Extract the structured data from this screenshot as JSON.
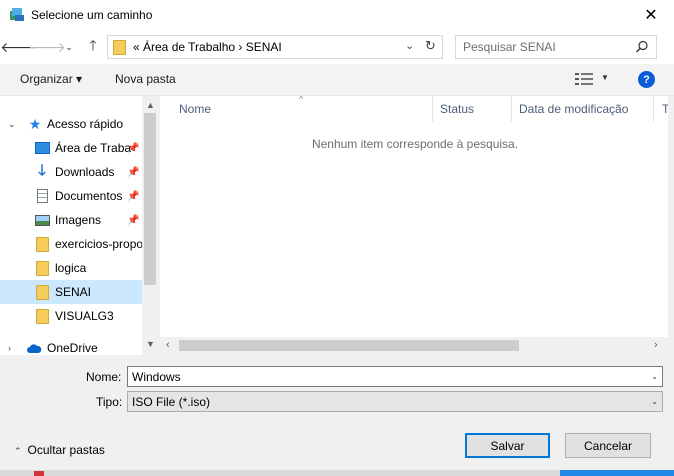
{
  "window": {
    "title": "Selecione um caminho",
    "close_glyph": "✕"
  },
  "nav": {
    "back": "🡐",
    "forward": "🡒",
    "recent": "⌄",
    "up": "🡑",
    "address": "« Área de Trabalho  ›  SENAI",
    "address_dropdown": "⌄",
    "refresh": "↻",
    "search_placeholder": "Pesquisar SENAI"
  },
  "toolbar": {
    "organize": "Organizar ▾",
    "new_folder": "Nova pasta",
    "view_arrow": "▼",
    "help": "?"
  },
  "sidebar": {
    "quick_access": "Acesso rápido",
    "items": [
      {
        "label": "Área de Traba",
        "icon": "desktop-icon",
        "pinned": true
      },
      {
        "label": "Downloads",
        "icon": "download-icon",
        "pinned": true
      },
      {
        "label": "Documentos",
        "icon": "document-icon",
        "pinned": true
      },
      {
        "label": "Imagens",
        "icon": "image-icon",
        "pinned": true
      },
      {
        "label": "exercicios-propo",
        "icon": "folder-icon",
        "pinned": false
      },
      {
        "label": "logica",
        "icon": "folder-icon",
        "pinned": false
      },
      {
        "label": "SENAI",
        "icon": "folder-icon",
        "pinned": false,
        "selected": true
      },
      {
        "label": "VISUALG3",
        "icon": "folder-icon",
        "pinned": false
      }
    ],
    "onedrive": "OneDrive",
    "expand_open": "⌄",
    "expand_closed": "›",
    "pin_glyph": "📌"
  },
  "filelist": {
    "columns": [
      "Nome",
      "Status",
      "Data de modificação",
      "T"
    ],
    "sort_glyph": "^",
    "empty_message": "Nenhum item corresponde à pesquisa."
  },
  "scroll": {
    "up": "▲",
    "down": "▼",
    "left": "‹",
    "right": "›"
  },
  "form": {
    "name_label": "Nome:",
    "name_value": "Windows",
    "type_label": "Tipo:",
    "type_value": "ISO File (*.iso)",
    "dropdown_arrow": "⌄"
  },
  "footer": {
    "hide_folders": "Ocultar pastas",
    "hide_chevron": "⌃",
    "save": "Salvar",
    "cancel": "Cancelar"
  },
  "colors": {
    "accent": "#0078d7",
    "selection": "#cce8ff",
    "folder": "#f3cc5c",
    "help": "#0a5bd7"
  }
}
